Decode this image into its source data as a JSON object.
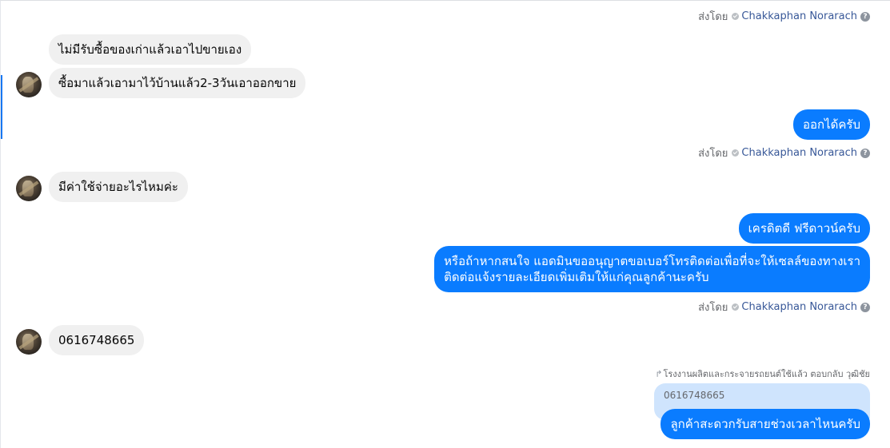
{
  "sent_by": {
    "prefix": "ส่งโดย",
    "name": "Chakkaphan Norarach",
    "help": "?"
  },
  "messages": {
    "in1": "ไม่มีรับซื้อของเก่าแล้วเอาไปขายเอง",
    "in2": "ซื้อมาแล้วเอามาไว้บ้านแล้ว2-3วันเอาออกขาย",
    "out1": "ออกได้ครับ",
    "in3": "มีค่าใช้จ่ายอะไรไหมค่ะ",
    "out2": "เครดิตดี ฟรีดาวน์ครับ",
    "out3_line1": "หรือถ้าหากสนใจ แอดมินขออนุญาตขอเบอร์โทรติดต่อเพื่อที่จะให้เซลล์ของทางเรา",
    "out3_line2": "ติดต่อแจ้งรายละเอียดเพิ่มเติมให้แก่คุณลูกค้านะครับ",
    "in4": "0616748665",
    "reply_note": "โรงงานผลิตและกระจายรถยนต์ใช้แล้ว ตอบกลับ วุฒิชัย",
    "quoted": "0616748665",
    "out4": "ลูกค้าสะดวกรับสายช่วงเวลาไหนครับ"
  },
  "colors": {
    "outgoing_bubble": "#0a7cff",
    "incoming_bubble": "#f0f0f0",
    "quoted_bubble": "#cfe4fd",
    "sender_name": "#385898"
  },
  "icons": {
    "verified": "verified-check-icon",
    "help": "help-circle-icon",
    "reply": "reply-arrow-icon"
  }
}
